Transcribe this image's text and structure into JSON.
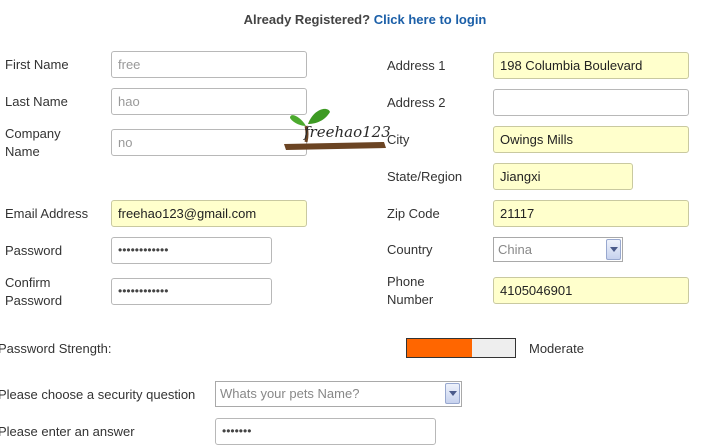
{
  "header": {
    "question": "Already Registered?",
    "link": "Click here to login"
  },
  "left": {
    "first_name": {
      "label": "First Name",
      "value": "free"
    },
    "last_name": {
      "label": "Last Name",
      "value": "hao"
    },
    "company": {
      "label_line1": "Company",
      "label_line2": "Name",
      "value": "no"
    },
    "email": {
      "label": "Email Address",
      "value": "freehao123@gmail.com"
    },
    "password": {
      "label": "Password",
      "value": "••••••••••••"
    },
    "confirm": {
      "label_line1": "Confirm",
      "label_line2": "Password",
      "value": "••••••••••••"
    }
  },
  "right": {
    "address1": {
      "label": "Address 1",
      "value": "198 Columbia Boulevard"
    },
    "address2": {
      "label": "Address 2",
      "value": ""
    },
    "city": {
      "label": "City",
      "value": "Owings Mills"
    },
    "state": {
      "label": "State/Region",
      "value": "Jiangxi"
    },
    "zip": {
      "label": "Zip Code",
      "value": "21117"
    },
    "country": {
      "label": "Country",
      "value": "China"
    },
    "phone": {
      "label_line1": "Phone",
      "label_line2": "Number",
      "value": "4105046901"
    }
  },
  "strength": {
    "label": "Password Strength:",
    "value": "Moderate",
    "level": 0.6,
    "color": "#ff6600"
  },
  "security": {
    "question_label": "Please choose a security question",
    "question_value": "Whats your pets Name?",
    "answer_label": "Please enter an answer",
    "answer_value": "•••••••"
  },
  "watermark": {
    "text": "freehao123"
  }
}
